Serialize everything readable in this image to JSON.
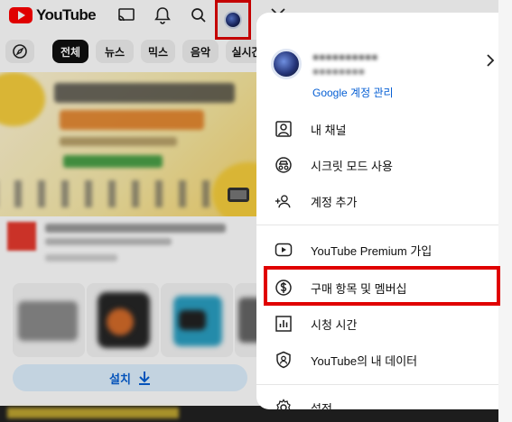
{
  "app": {
    "brand": "YouTube",
    "brand_color": "#ff0000",
    "highlight_color": "#e00000",
    "link_color": "#065fd4"
  },
  "topbar": {
    "icons": [
      "cast-icon",
      "bell-icon",
      "search-icon",
      "avatar",
      "close-icon"
    ]
  },
  "chips": [
    {
      "label": "",
      "icon": "compass-icon"
    },
    {
      "label": "전체",
      "active": true
    },
    {
      "label": "뉴스"
    },
    {
      "label": "믹스"
    },
    {
      "label": "음악"
    },
    {
      "label": "실시간"
    }
  ],
  "install": {
    "label": "설치"
  },
  "account": {
    "manage_label": "Google 계정 관리"
  },
  "menu": {
    "section1": [
      {
        "label": "내 채널",
        "icon": "person-box-icon"
      },
      {
        "label": "시크릿 모드 사용",
        "icon": "incognito-icon"
      },
      {
        "label": "계정 추가",
        "icon": "add-person-icon"
      }
    ],
    "section2": [
      {
        "label": "YouTube Premium 가입",
        "icon": "youtube-icon"
      },
      {
        "label": "구매 항목 및 멤버십",
        "icon": "dollar-circle-icon",
        "highlighted": true
      },
      {
        "label": "시청 시간",
        "icon": "bar-chart-icon"
      },
      {
        "label": "YouTube의 내 데이터",
        "icon": "shield-person-icon"
      }
    ],
    "section3": [
      {
        "label": "설정",
        "icon": "gear-icon"
      }
    ]
  }
}
